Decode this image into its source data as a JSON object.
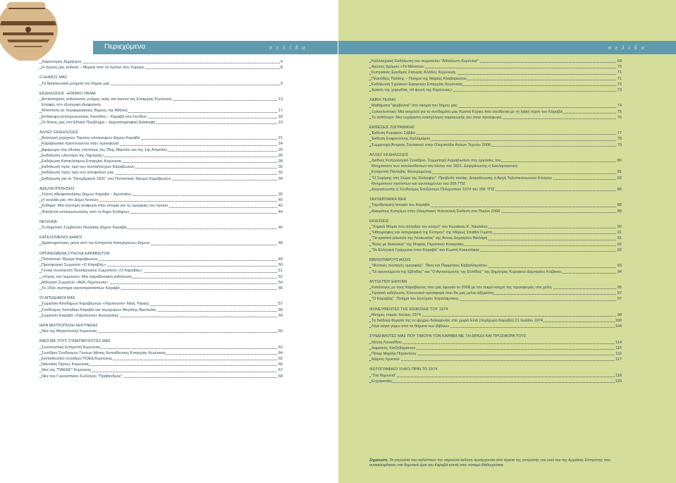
{
  "header": {
    "title": "Περιεχόμενα",
    "selida_left": "σ ε λ ί δ α",
    "selida_right": "σ ε λ ί δ α"
  },
  "left_sections": [
    {
      "heading": "",
      "items": [
        {
          "label": "Χαιρετισμός Δημάρχου",
          "page": "4"
        },
        {
          "label": "Η πρώτη μας έκδοση – Μερικά από τα σχόλια που πήραμε",
          "page": "8"
        }
      ]
    },
    {
      "heading": "Ο ΔΗΜΟΣ ΜΑΣ",
      "items": [
        {
          "label": "Τα θρησκευτικά μνημεία του δήμου μας",
          "page": "9"
        }
      ]
    },
    {
      "heading": "ΕΚΔΗΛΩΣΕΙΣ –ΕΘΝΙΚΟ ΘΕΜΑ",
      "items": [
        {
          "label": "Αντικατοχικές εκδηλώσεις μνήμης τιμής και αγώνα της Επαρχίας Κερύνειας",
          "page": "13"
        },
        {
          "label": "Επαφές στο εξωτερικό-Διαφώτιση",
          "page": ""
        },
        {
          "label": "Αποστολή σε περιφερειακούς δήμους της Αθήνας",
          "page": "17"
        },
        {
          "label": "Επίσκεψη αντιπροσωπείας Λαπήθου – Καραβά στο Λονδίνο",
          "page": "18"
        },
        {
          "label": "Οι θέσεις μας στο Εθνικό Πρόβλημα – Δημοσιογραφική Διάσκεψη",
          "page": "19"
        }
      ]
    },
    {
      "heading": "ΑΛΛΕΣ ΕΚΔΗΛΩΣΕΙΣ",
      "items": [
        {
          "label": "Απονομή χορηγιών Ταμείου υποτροφιών Δήμου Καραβά",
          "page": "21"
        },
        {
          "label": "Καραβιώτικα Χριστούγεννα στην προσφυγιά",
          "page": "24"
        },
        {
          "label": "Αφιέρωμα στις εθνικές επετείους της 25ης Μαρτίου και της 1ης Απριλίου",
          "page": "25"
        },
        {
          "label": "Εκδήλωση «Δευτέρα της Λαμπρής»",
          "page": "26"
        },
        {
          "label": "Εκδήλωση Κατακλυσμού Επαρχίας Κερύνειας",
          "page": "28"
        },
        {
          "label": "Εκδήλωση προς τιμή των συνταξιούχων Καραβιωτών",
          "page": "30"
        },
        {
          "label": "Εκδήλωση προς τιμή των αποφοίτων μας",
          "page": "32"
        },
        {
          "label": "Εκδήλωση για τα \"Οκτωβριανά 1931\" στο Πολιτιστικό Ίδρυμα Καραβιωτών",
          "page": "34"
        }
      ]
    },
    {
      "heading": "ΑΔΕΛΦΟΠΟΙΗΣΕΙΣ",
      "items": [
        {
          "label": "Τελετή αδελφοποίησης Δήμων Καραβά – Αμυνταίου",
          "page": "35"
        },
        {
          "label": "Η νεολαία μας στο Δήμο Λευκών",
          "page": "40"
        },
        {
          "label": "Κύθηρα: Μια σύντομη αναφορά στην ιστορία και τις ομορφιές του νησιού",
          "page": "42"
        },
        {
          "label": "Φιλοξενία αντιπροσωπείας από το Δήμο Κυθήρων",
          "page": "44"
        }
      ]
    },
    {
      "heading": "ΝΕΟΛΑΙΑ",
      "items": [
        {
          "label": "Το Δημοτικό Συμβούλιο Νεολαίας Δήμου Καραβά",
          "page": "46"
        }
      ]
    },
    {
      "heading": "ΚΑΤΕΧΟΜΕΝΟΙ ΔΗΜΟΙ",
      "items": [
        {
          "label": "Δραστηριότητες μέσα από την Επιτροπή Κατεχόμενων Δήμων",
          "page": "48"
        }
      ]
    },
    {
      "heading": "ΟΡΓΑΝΩΜΕΝΑ ΣΥΝΟΛΑ ΚΑΡΑΒΙΩΤΩΝ",
      "items": [
        {
          "label": "Πολιτιστικό Ίδρυμα Καραβιωτών",
          "page": "49"
        },
        {
          "label": "Προσφυγικό Σωματείο «Ο Καραβάς»",
          "page": "50"
        },
        {
          "label": "Γενική συνέλευση Προσφυγικού Σωματείου «Ο Καραβάς»",
          "page": "51"
        },
        {
          "label": "«Χορός του λεμονιού» Μια παραδοσιακή εκδήλωση",
          "page": "52"
        },
        {
          "label": "Αθλητικό Σωματείο «ΑΕΚ-Λάμπουσα»",
          "page": "54"
        },
        {
          "label": "Το 143ο σύστημα ναυτοπροσκόπων Καραβά",
          "page": "56"
        }
      ]
    },
    {
      "heading": "ΟΙ ΑΠΟΔΗΜΟΙ ΜΑΣ",
      "items": [
        {
          "label": "Σωματείο Αποδήμων Καραβιωτών «Λάμπουσα» Νέας Υόρκης",
          "page": "57"
        },
        {
          "label": "Σύνδεσμος Λαπηθιου-Καραβά και περιχώρων Μεγάλης Βρετανίας",
          "page": "58"
        },
        {
          "label": "Σωματείο Καραβά «Λάμπουσα» Αυστραλίας",
          "page": "59"
        }
      ]
    },
    {
      "heading": "ΙΕΡΑ ΜΗΤΡΟΠΟΛΗ ΚΕΡΥΝΕΙΑΣ",
      "items": [
        {
          "label": "Νέα της Μητρόπολης Κερύνειας",
          "page": "60"
        }
      ]
    },
    {
      "heading": "ΜΑΖΙ ΜΕ ΤΟΥΣ ΣΥΝΕΠΑΡΧΙΩΤΕΣ ΜΑΣ",
      "items": [
        {
          "label": "Συντονιστική Επιτροπή Κερύνειας",
          "page": "62"
        },
        {
          "label": "Συνέδριο Συνδέσμου Γονέων Μέσης Εκπαίδευσης Επαρχίας Κερύνειας",
          "page": "64"
        },
        {
          "label": "Εκπαιδευτικό συνέδριο ΠΟΕΔ Κερύνειας",
          "page": "65"
        },
        {
          "label": "Ναυτικός Όμιλος Κερύνειας",
          "page": "66"
        },
        {
          "label": "Νέα της \"ΠΑΕΕΚ\" Κερύνειας",
          "page": "67"
        },
        {
          "label": "Νέα του Γυμναστικού Συλλόγου \"Πράξανδρος\"",
          "page": "68"
        }
      ]
    }
  ],
  "right_sections": [
    {
      "heading": "",
      "items": [
        {
          "label": "Καλλιτεχνική Εκδήλωση του σωματείου \"Αδούλωτη Κερύνεια\"",
          "page": "69"
        },
        {
          "label": "Αγώνες δρόμου «Τα Μάτσεια»",
          "page": "70"
        },
        {
          "label": "Κυπριακός Ερυθρός Σταυρός-Κλάδος Κερύνειας",
          "page": "71"
        },
        {
          "label": "Πλανόδιος Πολίτης – Ποίημα της Μαρίας Κλαβαριώτου",
          "page": "71"
        },
        {
          "label": "Εκδήλωση Σχολικών Εφορειών Επαρχίας Κερύνειας",
          "page": "72"
        },
        {
          "label": "Δράση της χορωδίας «Η φωνή της Κερύνειας»",
          "page": "73"
        }
      ]
    },
    {
      "heading": "ΛΑΙΚΗ ΤΕΧΝΗ",
      "items": [
        {
          "label": "Μαθήματα \"φερβολιτέ\" στο οίκημα του δήμου μας",
          "page": "74"
        },
        {
          "label": "Ξυλογλυπτική: Μια ασχολία για το συνδημότη μας Κώστα Κύρκο που συνδέεται με τη λαϊκή τέχνη του Καραβά",
          "page": "75"
        },
        {
          "label": "Το ανθόνερο: Μια ευχάριστη ενασχόληση παραγωγής του στην προσφυγιά",
          "page": "76"
        }
      ]
    },
    {
      "heading": "ΕΚΘΕΣΕΙΣ ΖΩΓΡΑΦΙΚΗΣ",
      "items": [
        {
          "label": "Έκθεση Κυριάκου Σάββα",
          "page": "77"
        },
        {
          "label": "Έκθεση Ευφροσύνης Καλλιμάχου",
          "page": "78"
        },
        {
          "label": "Συμμετοχή Άντρεας Στυλιανού στην Ολυμπιάδα Καλών Τεχνών 2008",
          "page": "79"
        }
      ]
    },
    {
      "heading": "ΑΛΛΕΣ ΕΚΔΗΛΩΣΕΙΣ",
      "items": [
        {
          "label": "Διεθνές Κυπρολογικό Συνέδριο. Συμμετοχή Καραβιωτών στις εργασίες του",
          "page": "80"
        },
        {
          "label": "Μνημόσυνο των εκτελεσθέντων τον Ιούλιο του 1821. Διοργάνωσης ή Εκκλησιαστική",
          "page": ""
        },
        {
          "label": "Επιτροπή Παναγίας Φανερωμένης",
          "page": "81"
        },
        {
          "label": "\"Ο Σεφέρης στη Χώρα της Έκλειψης\". Προβολή ταινίας. Διοργάνωσής ή Αρχή Τηλεπικοινωνιών Κύπρου",
          "page": "83"
        },
        {
          "label": "Μνημόσυνο πεσόντων και αγνοουμένων του 256 ΤΠΖ",
          "page": ""
        },
        {
          "label": "Διοργάνωσής ή Σύνδεσμος Επιζώντων Πολεμιστών 1974 του 256 ΤΠΖ",
          "page": "85"
        }
      ]
    },
    {
      "heading": "ΤΑΧΥΔΡΟΜΙΚΑ ΝΕΑ",
      "items": [
        {
          "label": "Ταχυδρομική Ιστορία του Καραβά",
          "page": "88"
        },
        {
          "label": "Διακρίσεις Κυπρίων στην Ολυμπιακή Φιλοτελική Έκθεση στο Πεκίνο 2008",
          "page": "89"
        }
      ]
    },
    {
      "heading": "ΕΚΔΟΣΕΙΣ",
      "items": [
        {
          "label": "\"Χημικά Μόρια που άλλαξαν τον κόσμο\" του Κυριάκου Κ. Νικολάου",
          "page": "90"
        },
        {
          "label": "\"Ηθογραφίες και λαογραφικά της Κύπρου\" της Μάρως Σπαθιά Γεμέτα",
          "page": "91"
        },
        {
          "label": "\"Τα κρατικά μουσεία της Λευκωσίας\" της Άννας Δημητρίου Βιολάρη",
          "page": "91"
        },
        {
          "label": "\"Βολς με δεκανίκια\" της Μαρίας Περατικού Κοκαράκη",
          "page": "92"
        },
        {
          "label": "\"Τα Ελληνικά Γράμματα στον Καραβά\" του Κωστή Κοκκινόφτα",
          "page": "92"
        }
      ]
    },
    {
      "heading": "ΒΙΒΛΙΟΠΑΡΟΥΣΙΑΣΕΙΣ",
      "items": [
        {
          "label": "\"Φυσικές συνταγές ομορφιάς\". Τάκη και Παρμίτσας Καβαλλιεράτου",
          "page": "93"
        },
        {
          "label": "\"Οι αγνοούμενοι της Εβίτιδας\" και \"Ο Αγνοούμενος της Ελπίδας\" της Δήμητρας Κυριακού-Δημητρίου Κοζάκου",
          "page": "94"
        }
      ]
    },
    {
      "heading": "ΑΥΤΟΙ ΠΟΥ ΕΦΥΓΑΝ",
      "items": [
        {
          "label": "Κατάλογος με τους Καραβιώτες που μας έφυγαν το 2008 με τον πικρό καημό της προσφυγιάς στα χείλη",
          "page": "95"
        },
        {
          "label": "Τιμητική εκδήλωση. Κοινωνικά προσφορά που θα μας μείνει αξέχαστη",
          "page": "97"
        },
        {
          "label": "\"Ο Καραβάς\". Ποίημα του Ευτύχιου Χαραλάμπους",
          "page": "97"
        }
      ]
    },
    {
      "heading": "ΦΟΝΕΥΘΕΝΤΕΣ ΤΗΣ ΕΙΣΒΟΛΗΣ ΤΟΥ 1974",
      "items": [
        {
          "label": "Μνήμες πικρές Ιούλιος 1974",
          "page": "98"
        },
        {
          "label": "Τα διάδεκα θύματα της εν ψυχρώ δολοφονίας στο χωριό Ελιά (περίχωρο Καραβά) 21 Ιουλίου 1974",
          "page": "100"
        },
        {
          "label": "Λίγα λόγια γύρω από τα θύματα των βιβλίων",
          "page": "104"
        }
      ]
    },
    {
      "heading": "ΣΥΝΔΗΜΟΤΕΣ ΜΑΣ ΠΟΥ ΤΙΜΟΥΝ ΤΟΝ ΚΑΡΑΒΑ ΜΕ ΤΗ ΔΡΑΣΗ ΚΑΙ ΠΡΟΣΦΟΡΑ ΤΟΥΣ",
      "items": [
        {
          "label": "Νέλλη Λουκαΐδου",
          "page": "114"
        },
        {
          "label": "Δαμιανός Χατζηδαμιανού",
          "page": "115"
        },
        {
          "label": "Πάτερ Μιχαήλ Πηγαντύου",
          "page": "116"
        },
        {
          "label": "Μάριος Χριστού",
          "page": "117"
        }
      ]
    },
    {
      "heading": "ΦΩΤΟΓΡΑΦΙΚΟ ΥΛΙΚΟ ΠΡΙΝ ΤΟ 1974",
      "items": [
        {
          "label": "\"Στη θημωνιά\"",
          "page": "118"
        },
        {
          "label": "Ευχαριστίες",
          "page": "120"
        }
      ]
    }
  ],
  "note": {
    "prefix": "Σημείωση:",
    "text": "Τα γεγονότα που καλύπτουν την παρούσα έκδοση προέρχονται από τέρατα της επιτροπής του υιού του της Αρχαϊκής Επιτροπής που ανακαλύφθηκαν στα δημοτικά όρια του Καραβά κοντά στον ποταμό Βαθυρρύακα"
  },
  "colors": {
    "bar": "#5f9aae",
    "right_bg": "#d5dd9a"
  },
  "image": {
    "icon": "clay-pot-image"
  }
}
